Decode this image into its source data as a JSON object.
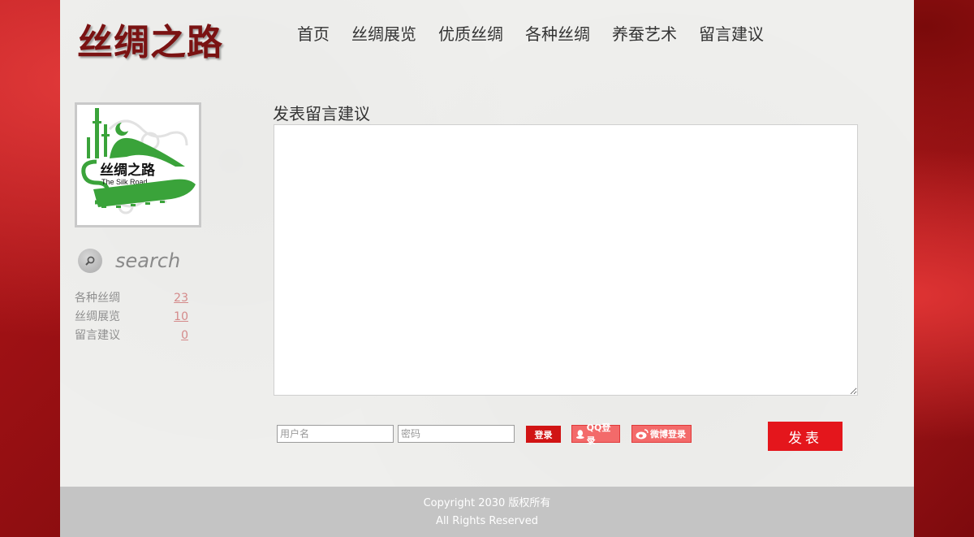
{
  "header": {
    "logo_text": "丝绸之路",
    "nav": [
      "首页",
      "丝绸展览",
      "优质丝绸",
      "各种丝绸",
      "养蚕艺术",
      "留言建议"
    ]
  },
  "sidebar": {
    "emblem": {
      "title": "丝绸之路",
      "subtitle": "The Silk Road"
    },
    "search_label": "search",
    "categories": [
      {
        "name": "各种丝绸",
        "count": "23"
      },
      {
        "name": "丝绸展览",
        "count": "10"
      },
      {
        "name": "留言建议",
        "count": "0"
      }
    ]
  },
  "form": {
    "title": "发表留言建议",
    "message_value": "",
    "username_placeholder": "用户名",
    "password_placeholder": "密码",
    "login_label": "登录",
    "qq_login_label": "QQ登录",
    "weibo_login_label": "微博登录",
    "submit_label": "发表"
  },
  "footer": {
    "copyright": "Copyright 2030 版权所有",
    "rights": "All Rights Reserved"
  },
  "colors": {
    "logo": "#7a1212",
    "emblem_green": "#3aa33a",
    "primary_red": "#e4161c",
    "footer_bg": "#c4c4c4"
  }
}
